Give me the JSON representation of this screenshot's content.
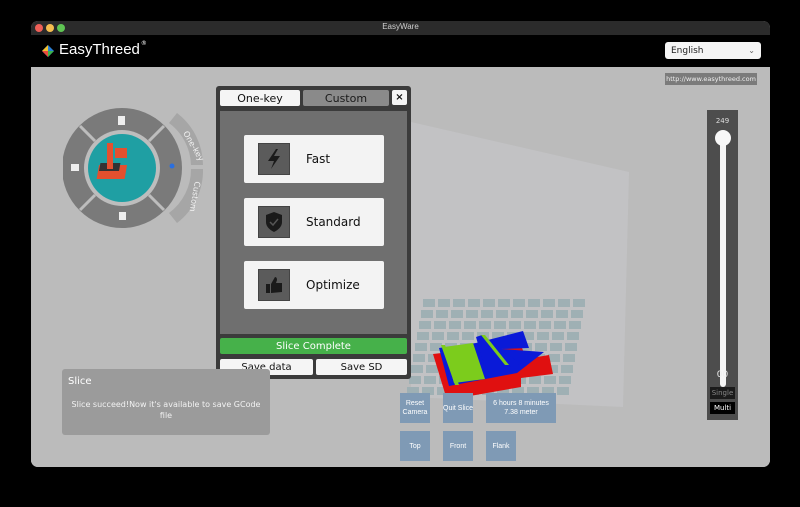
{
  "window": {
    "title": "EasyWare"
  },
  "header": {
    "brand": "EasyThreed",
    "brand_mark": "®",
    "language": {
      "selected": "English"
    }
  },
  "url_label": "http://www.easythreed.com",
  "radial_menu": {
    "items": [
      {
        "name": "file-icon"
      },
      {
        "name": "model-library-icon"
      },
      {
        "name": "slice-icon"
      },
      {
        "name": "delete-icon"
      }
    ],
    "side_tabs": [
      "One-key",
      "Custom"
    ]
  },
  "dialog": {
    "tabs": [
      {
        "label": "One-key",
        "active": true
      },
      {
        "label": "Custom",
        "active": false
      }
    ],
    "close_label": "×",
    "modes": [
      {
        "label": "Fast",
        "icon": "lightning-icon"
      },
      {
        "label": "Standard",
        "icon": "shield-check-icon"
      },
      {
        "label": "Optimize",
        "icon": "thumbs-up-icon"
      }
    ],
    "status": "Slice Complete",
    "status_color": "#46b14a",
    "save_data_label": "Save data",
    "save_sd_label": "Save SD"
  },
  "info_box": {
    "title": "Slice",
    "message": "Slice succeed!Now it's available to save GCode file"
  },
  "view_controls": {
    "reset_camera": "Reset Camera",
    "quit_slice": "Quit Slice",
    "estimate_time": "6 hours 8 minutes",
    "estimate_length": "7.38 meter",
    "top": "Top",
    "front": "Front",
    "flank": "Flank"
  },
  "layer_slider": {
    "max_value": "249",
    "min_value": "00",
    "position_fraction": 1.0,
    "single_label": "Single",
    "multi_label": "Multi"
  }
}
